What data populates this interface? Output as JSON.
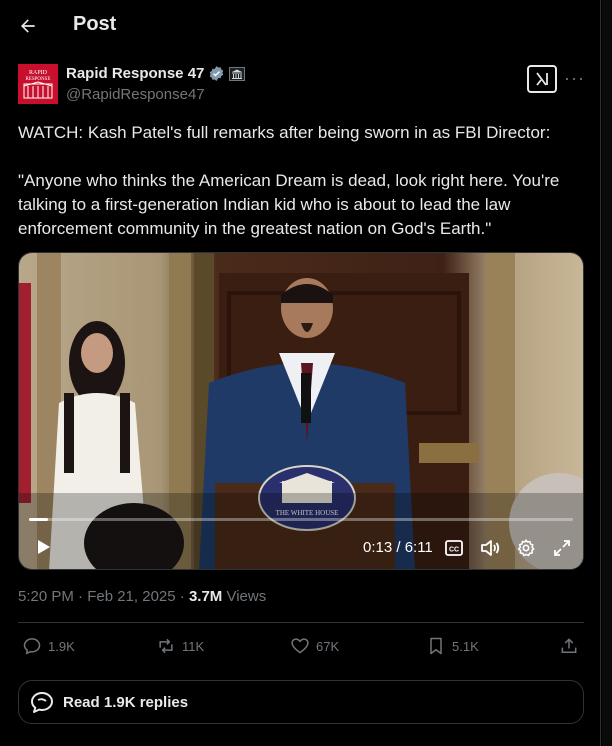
{
  "header": {
    "title": "Post"
  },
  "author": {
    "name": "Rapid Response 47",
    "handle": "@RapidResponse47",
    "avatar_text": "RAPID RESPONSE",
    "verified_color": "#829aab"
  },
  "tweet": {
    "text": "WATCH: Kash Patel's full remarks after being sworn in as FBI Director:\n\n\"Anyone who thinks the American Dream is dead, look right here. You're talking to a first-generation Indian kid who is about to lead the law enforcement community in the greatest nation on God's Earth.\""
  },
  "video": {
    "time": "0:13 / 6:11",
    "progress": 0.035,
    "podium_seal_text": "THE WHITE HOUSE"
  },
  "meta": {
    "timestamp": "5:20 PM · Feb 21, 2025",
    "separator": "·",
    "views_count": "3.7M",
    "views_label": "Views"
  },
  "actions": {
    "replies": "1.9K",
    "reposts": "11K",
    "likes": "67K",
    "bookmarks": "5.1K"
  },
  "read_replies": {
    "label": "Read 1.9K replies"
  },
  "colors": {
    "background": "#000000",
    "text": "#e7e9ea",
    "muted": "#71767b",
    "border": "#2f3336"
  }
}
